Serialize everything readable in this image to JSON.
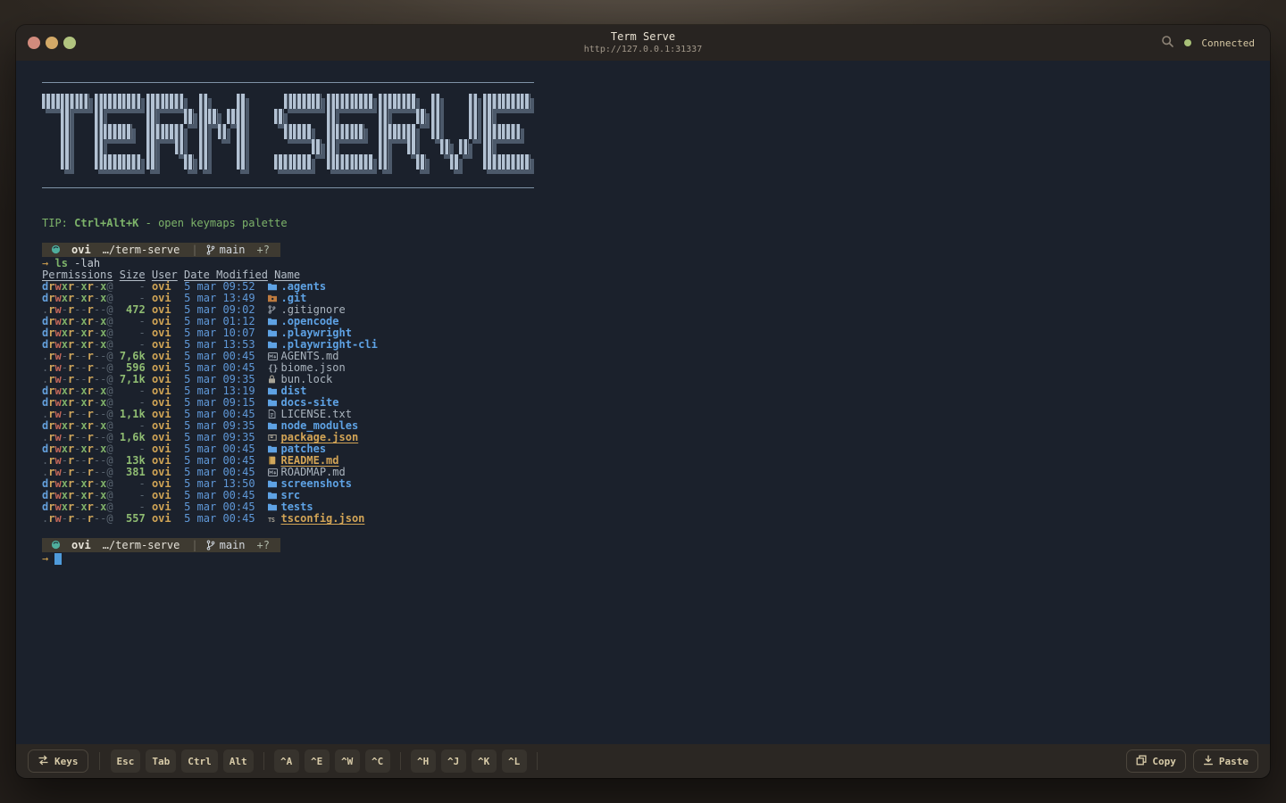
{
  "window": {
    "title": "Term Serve",
    "url": "http://127.0.0.1:31337",
    "connection_status": "Connected"
  },
  "banner": {
    "text": "TERM SERVE"
  },
  "tip": {
    "label": "TIP:",
    "hotkey": "Ctrl+Alt+K",
    "description": "- open keymaps palette"
  },
  "prompt": {
    "user": "ovi",
    "path": "…/term-serve",
    "separator": "|",
    "branch": "main",
    "git_status": "+?"
  },
  "command": {
    "symbol": "→",
    "program": "ls",
    "args": "-lah"
  },
  "cursor_line": {
    "symbol": "→"
  },
  "listing": {
    "headers": {
      "permissions": "Permissions",
      "size": "Size",
      "user": "User",
      "date": "Date Modified",
      "name": "Name"
    },
    "rows": [
      {
        "perms": "drwxr-xr-x@",
        "size": "-",
        "user": "ovi",
        "date": "5 mar 09:52",
        "icon": "folder",
        "name": ".agents",
        "kind": "dir"
      },
      {
        "perms": "drwxr-xr-x@",
        "size": "-",
        "user": "ovi",
        "date": "5 mar 13:49",
        "icon": "git-folder",
        "name": ".git",
        "kind": "dir"
      },
      {
        "perms": ".rw-r--r--@",
        "size": "472",
        "user": "ovi",
        "date": "5 mar 09:02",
        "icon": "git-branch",
        "name": ".gitignore",
        "kind": "file"
      },
      {
        "perms": "drwxr-xr-x@",
        "size": "-",
        "user": "ovi",
        "date": "5 mar 01:12",
        "icon": "folder",
        "name": ".opencode",
        "kind": "dir"
      },
      {
        "perms": "drwxr-xr-x@",
        "size": "-",
        "user": "ovi",
        "date": "5 mar 10:07",
        "icon": "folder",
        "name": ".playwright",
        "kind": "dir"
      },
      {
        "perms": "drwxr-xr-x@",
        "size": "-",
        "user": "ovi",
        "date": "5 mar 13:53",
        "icon": "folder",
        "name": ".playwright-cli",
        "kind": "dir"
      },
      {
        "perms": ".rw-r--r--@",
        "size": "7,6k",
        "user": "ovi",
        "date": "5 mar 00:45",
        "icon": "markdown",
        "name": "AGENTS.md",
        "kind": "file"
      },
      {
        "perms": ".rw-r--r--@",
        "size": "596",
        "user": "ovi",
        "date": "5 mar 00:45",
        "icon": "braces",
        "name": "biome.json",
        "kind": "file"
      },
      {
        "perms": ".rw-r--r--@",
        "size": "7,1k",
        "user": "ovi",
        "date": "5 mar 09:35",
        "icon": "lock",
        "name": "bun.lock",
        "kind": "file"
      },
      {
        "perms": "drwxr-xr-x@",
        "size": "-",
        "user": "ovi",
        "date": "5 mar 13:19",
        "icon": "folder",
        "name": "dist",
        "kind": "dir"
      },
      {
        "perms": "drwxr-xr-x@",
        "size": "-",
        "user": "ovi",
        "date": "5 mar 09:15",
        "icon": "folder",
        "name": "docs-site",
        "kind": "dir"
      },
      {
        "perms": ".rw-r--r--@",
        "size": "1,1k",
        "user": "ovi",
        "date": "5 mar 00:45",
        "icon": "document",
        "name": "LICENSE.txt",
        "kind": "file"
      },
      {
        "perms": "drwxr-xr-x@",
        "size": "-",
        "user": "ovi",
        "date": "5 mar 09:35",
        "icon": "folder",
        "name": "node_modules",
        "kind": "dir"
      },
      {
        "perms": ".rw-r--r--@",
        "size": "1,6k",
        "user": "ovi",
        "date": "5 mar 09:35",
        "icon": "package",
        "name": "package.json",
        "kind": "special"
      },
      {
        "perms": "drwxr-xr-x@",
        "size": "-",
        "user": "ovi",
        "date": "5 mar 00:45",
        "icon": "folder",
        "name": "patches",
        "kind": "dir"
      },
      {
        "perms": ".rw-r--r--@",
        "size": "13k",
        "user": "ovi",
        "date": "5 mar 00:45",
        "icon": "book",
        "name": "README.md",
        "kind": "special"
      },
      {
        "perms": ".rw-r--r--@",
        "size": "381",
        "user": "ovi",
        "date": "5 mar 00:45",
        "icon": "markdown",
        "name": "ROADMAP.md",
        "kind": "file"
      },
      {
        "perms": "drwxr-xr-x@",
        "size": "-",
        "user": "ovi",
        "date": "5 mar 13:50",
        "icon": "folder",
        "name": "screenshots",
        "kind": "dir"
      },
      {
        "perms": "drwxr-xr-x@",
        "size": "-",
        "user": "ovi",
        "date": "5 mar 00:45",
        "icon": "folder",
        "name": "src",
        "kind": "dir"
      },
      {
        "perms": "drwxr-xr-x@",
        "size": "-",
        "user": "ovi",
        "date": "5 mar 00:45",
        "icon": "folder",
        "name": "tests",
        "kind": "dir"
      },
      {
        "perms": ".rw-r--r--@",
        "size": "557",
        "user": "ovi",
        "date": "5 mar 00:45",
        "icon": "ts",
        "name": "tsconfig.json",
        "kind": "special"
      }
    ]
  },
  "toolbar": {
    "keys_button": "Keys",
    "key_groups": [
      [
        "Esc",
        "Tab",
        "Ctrl",
        "Alt"
      ],
      [
        "^A",
        "^E",
        "^W",
        "^C"
      ],
      [
        "^H",
        "^J",
        "^K",
        "^L"
      ]
    ],
    "copy_button": "Copy",
    "paste_button": "Paste"
  },
  "icons": {
    "keys": "swap-arrows",
    "copy": "overlapping-squares",
    "paste": "download-arrow",
    "titlebar": "magnifier-search",
    "prompt_leading": "teal-os-circle",
    "prompt_branch": "git-branch"
  },
  "colors": {
    "green": "#7db36a",
    "yellow": "#d1a75b",
    "red": "#c4685a",
    "blue": "#64a0dc",
    "date-blue": "#5f98d8",
    "dim-gray": "#59646f",
    "text-gray": "#aab4be",
    "tan": "#d8cba8",
    "special-yellow": "#d2a456",
    "size-green": "#8fbc72",
    "user-orange": "#d0a455",
    "cursor-blue": "#4f9bdb",
    "teal": "#4fae9d",
    "status-green": "#a9c178",
    "terminal-bg": "#1b212c",
    "bar-bg": "#2b2723",
    "prompt-bg": "#3e3a31"
  }
}
